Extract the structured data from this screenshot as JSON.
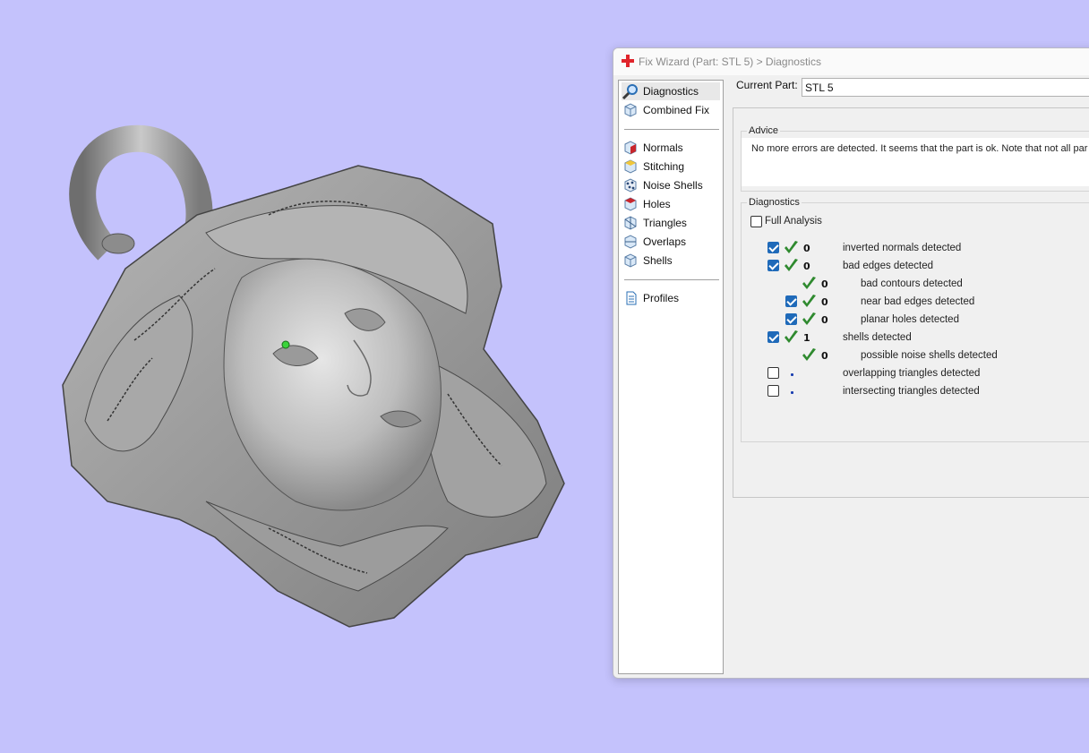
{
  "window": {
    "title": "Fix Wizard (Part: STL 5) > Diagnostics"
  },
  "nav": {
    "items": [
      {
        "label": "Diagnostics",
        "icon": "magnifier-icon",
        "selected": true
      },
      {
        "label": "Combined Fix",
        "icon": "cube-icon"
      },
      {
        "label": "Normals",
        "icon": "normals-cube-icon"
      },
      {
        "label": "Stitching",
        "icon": "stitching-cube-icon"
      },
      {
        "label": "Noise Shells",
        "icon": "noise-shells-icon"
      },
      {
        "label": "Holes",
        "icon": "holes-cube-icon"
      },
      {
        "label": "Triangles",
        "icon": "triangles-cube-icon"
      },
      {
        "label": "Overlaps",
        "icon": "overlaps-cube-icon"
      },
      {
        "label": "Shells",
        "icon": "shells-cube-icon"
      },
      {
        "label": "Profiles",
        "icon": "document-icon"
      }
    ]
  },
  "current_part": {
    "label": "Current Part:",
    "value": "STL 5"
  },
  "advice": {
    "title": "Advice",
    "text": "No more errors are detected. It seems that the part is ok. Note that not all par"
  },
  "diagnostics": {
    "title": "Diagnostics",
    "full_analysis_label": "Full Analysis",
    "full_analysis_checked": false,
    "rows": [
      {
        "checkbox": true,
        "checked": true,
        "status": "ok",
        "count": "0",
        "label": "inverted normals detected",
        "indent": 0
      },
      {
        "checkbox": true,
        "checked": true,
        "status": "ok",
        "count": "0",
        "label": "bad edges detected",
        "indent": 0
      },
      {
        "checkbox": false,
        "checked": false,
        "status": "ok",
        "count": "0",
        "label": "bad contours detected",
        "indent": 1
      },
      {
        "checkbox": true,
        "checked": true,
        "status": "ok",
        "count": "0",
        "label": "near bad edges detected",
        "indent": 1
      },
      {
        "checkbox": true,
        "checked": true,
        "status": "ok",
        "count": "0",
        "label": "planar holes detected",
        "indent": 1
      },
      {
        "checkbox": true,
        "checked": true,
        "status": "ok",
        "count": "1",
        "label": "shells detected",
        "indent": 0
      },
      {
        "checkbox": false,
        "checked": false,
        "status": "ok",
        "count": "0",
        "label": "possible noise shells detected",
        "indent": 1
      },
      {
        "checkbox": true,
        "checked": false,
        "status": "pending",
        "count": "",
        "label": "overlapping triangles detected",
        "indent": 0
      },
      {
        "checkbox": true,
        "checked": false,
        "status": "pending",
        "count": "",
        "label": "intersecting triangles detected",
        "indent": 0
      }
    ]
  },
  "colors": {
    "viewport_background": "#c4c2fc",
    "checkbox_accent": "#1f6ab9",
    "ok_tick": "#2f8a2f",
    "pending_dot": "#1b3fb0"
  }
}
